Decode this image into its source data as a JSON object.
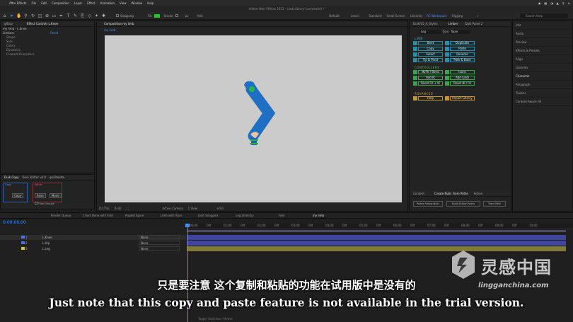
{
  "menubar": {
    "apple": "",
    "items": [
      "After Effects",
      "File",
      "Edit",
      "Composition",
      "Layer",
      "Effect",
      "Animation",
      "View",
      "Window",
      "Help"
    ],
    "right": [
      "◉",
      "▦",
      "◑",
      "▲",
      "⚲",
      "≡"
    ]
  },
  "window_title": "Adobe After Effects 2021 - Limb Library (converted) *",
  "toolbar": {
    "snapping_label": "Snapping",
    "fill_label": "Fill:",
    "stroke_label": "Stroke:",
    "px_label": "px",
    "add_label": "Add:",
    "fill_color": "#27c427"
  },
  "workspaces": [
    "Default",
    "Learn",
    "Standard",
    "Small Screen",
    "Libraries",
    "RC Workspace",
    "Rigging",
    "»"
  ],
  "search_help": "Search Help",
  "left_panel": {
    "tabs": [
      "g/Duo",
      "Effect Controls L.Knee"
    ],
    "tree_header": "my limb - L.Knee",
    "tree_items": [
      "Limbaer",
      "Shape",
      "Sole",
      "Colors",
      "Dynamics",
      "Forward Kinematics"
    ],
    "tree_value": "Reset"
  },
  "duik_panel": {
    "tabs": [
      "Duik Copy",
      "Duik Shifter v4.0",
      "gui/Palette"
    ],
    "copy_label": "Copy",
    "save_label": "Save",
    "move_label": "Move",
    "overlap_label": "Flow through",
    "section_a": "Copy",
    "section_b": "Adjust"
  },
  "comp_panel": {
    "tab": "Composition my limb",
    "sub_tab": "my limb",
    "viewer_bar": [
      "(117%)",
      "(Full)",
      "⬚",
      "Active Camera",
      "1 View",
      "+0.0"
    ]
  },
  "right_panel": {
    "tabs": [
      "Duik/V5_A_Styles",
      "Limber",
      "Duik Panel 2"
    ],
    "dropdown_a": "Leg",
    "type_label": "Type:",
    "dropdown_b": "Taper",
    "sections": [
      "LIMB",
      "CONTROLLERS",
      "ADVANCED"
    ],
    "buttons_left": [
      "Bent",
      "Copy",
      "Select",
      "Tip & Pivot",
      "IK/FK / Bend",
      "Add IK",
      "Reset FK + IK",
      "Help"
    ],
    "buttons_right": [
      "Duplicate",
      "Paste",
      "Rename",
      "Path & Base",
      "Icons",
      "Add Limb",
      "Reset IK / FK",
      "Import Library"
    ],
    "bottom_tabs": [
      "Content",
      "Create Nulls From Paths",
      "Action"
    ],
    "bottom_buttons": [
      "Points Follow Nulls",
      "Nulls Follow Points",
      "Trace Path"
    ]
  },
  "info_panel": {
    "items": [
      "Info",
      "Audio",
      "Preview",
      "Effects & Presets",
      "Align",
      "Libraries",
      "Character",
      "Paragraph",
      "Tracker",
      "Content-Aware Fill"
    ],
    "selected": "Character"
  },
  "timeline": {
    "tabs": [
      "Render Queue",
      "1.Sect Bone with Fold",
      "Angled Spine",
      "Limb with Toon",
      "Joint Snapped",
      "Leg Stretchy",
      "Fold",
      "my limb"
    ],
    "active_tab": "my limb",
    "timecode": "0;00;00;00",
    "ruler": [
      "00;00",
      "00f",
      "01;00",
      "00f",
      "02;00",
      "00f",
      "03;00",
      "00f",
      "04;00",
      "00f",
      "05;00",
      "00f",
      "06;00",
      "00f",
      "07;00",
      "00f",
      "08;00",
      "00f",
      "09;00",
      "00f",
      "10;00"
    ],
    "layers": [
      {
        "num": "1",
        "name": "L.Knee",
        "parent": "None",
        "color": "#4a7ad9"
      },
      {
        "num": "2",
        "name": "L.Hip",
        "parent": "None",
        "color": "#4a7ad9"
      },
      {
        "num": "3",
        "name": "L.Leg",
        "parent": "None",
        "color": "#d6c43c"
      }
    ],
    "toggle_label": "Toggle Switches / Modes"
  },
  "subtitles": {
    "chinese": "只是要注意 这个复制和粘贴的功能在试用版中是没有的",
    "english": "Just note that this copy and paste feature is not available in the trial version."
  },
  "watermark": {
    "name": "灵感中国",
    "url": "lingganchina.com"
  }
}
